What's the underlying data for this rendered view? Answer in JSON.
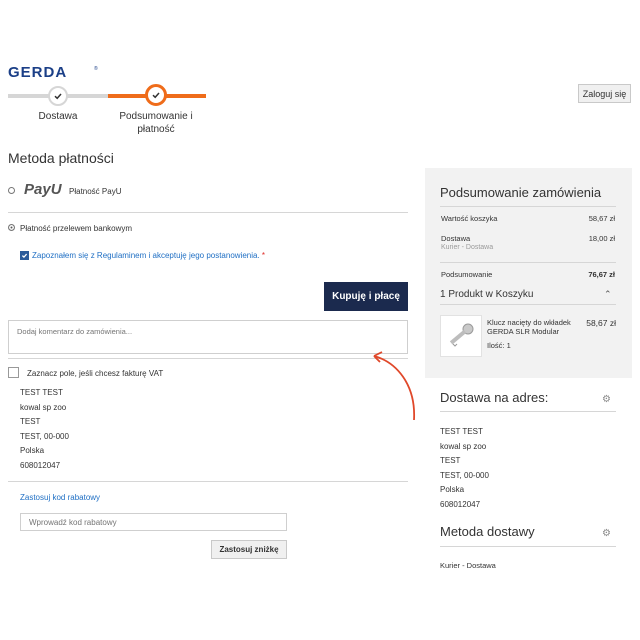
{
  "header": {
    "logo_text": "GERDA",
    "login_label": "Zaloguj się"
  },
  "progress": {
    "steps": [
      {
        "label": "Dostawa",
        "state": "done"
      },
      {
        "label": "Podsumowanie i płatność",
        "state": "current"
      }
    ]
  },
  "payment": {
    "title": "Metoda płatności",
    "payu_brand": "PayU",
    "payu_label": "Płatność PayU",
    "transfer_label": "Płatność przelewem bankowym",
    "terms_text": "Zapoznałem się z Regulaminem i akceptuję jego postanowienia.",
    "terms_required_mark": "*",
    "buy_button": "Kupuję i płacę",
    "comment_placeholder": "Dodaj komentarz do zamówienia..."
  },
  "invoice": {
    "checkbox_label": "Zaznacz pole, jeśli chcesz fakturę VAT"
  },
  "billing_address": {
    "lines": [
      "TEST TEST",
      "kowal sp zoo",
      "TEST",
      "TEST, 00-000",
      "Polska"
    ],
    "phone": "608012047"
  },
  "discount": {
    "link_label": "Zastosuj kod rabatowy",
    "placeholder": "Wprowadź kod rabatowy",
    "apply_button": "Zastosuj zniżkę"
  },
  "summary": {
    "title": "Podsumowanie zamówienia",
    "cart_value_label": "Wartość koszyka",
    "cart_value": "58,67 zł",
    "shipping_label": "Dostawa",
    "shipping_value": "18,00 zł",
    "shipping_method_sub": "Kurier - Dostawa",
    "total_label": "Podsumowanie",
    "total_value": "76,67 zł",
    "cart_items_label": "1 Produkt w Koszyku",
    "product": {
      "name": "Klucz nacięty do wkładek GERDA SLR Modular",
      "price": "58,67 zł",
      "qty": "Ilość: 1"
    }
  },
  "delivery_address": {
    "title": "Dostawa na adres:",
    "lines": [
      "TEST TEST",
      "kowal sp zoo",
      "TEST",
      "TEST, 00-000",
      "Polska"
    ],
    "phone": "608012047"
  },
  "delivery_method": {
    "title": "Metoda dostawy",
    "value": "Kurier - Dostawa"
  },
  "colors": {
    "accent": "#ef6c1a",
    "primary_button": "#1b2a4e",
    "brand_blue": "#1b3f87",
    "link": "#1f6fc4"
  }
}
